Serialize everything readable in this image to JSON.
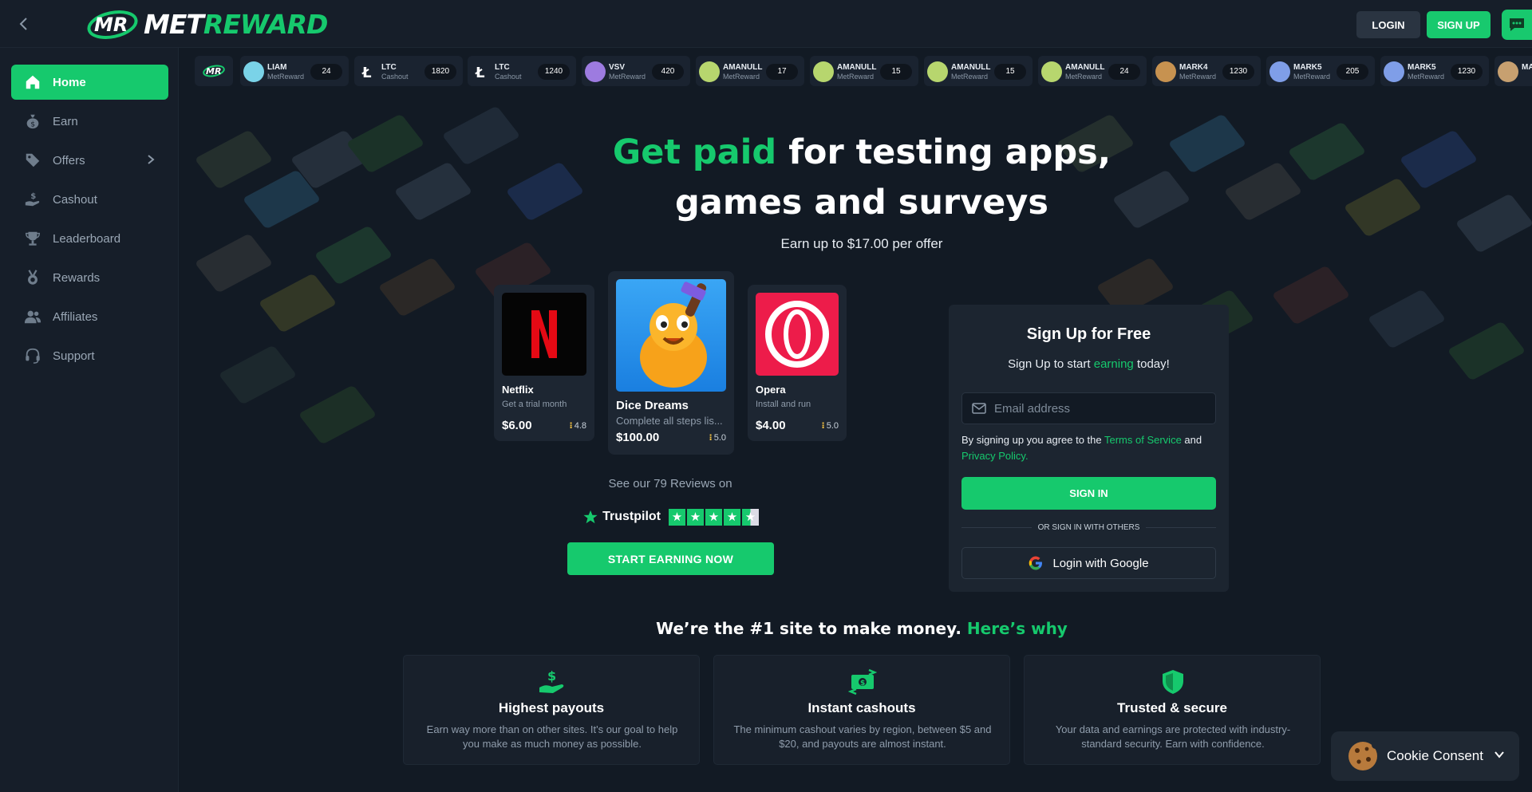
{
  "brand": {
    "name_part1": "MET",
    "name_part2": "REWARD",
    "accent": "#16c96d"
  },
  "header": {
    "login_label": "LOGIN",
    "signup_label": "SIGN UP"
  },
  "sidebar": {
    "items": [
      {
        "label": "Home",
        "icon": "home-icon"
      },
      {
        "label": "Earn",
        "icon": "money-bag-icon"
      },
      {
        "label": "Offers",
        "icon": "tag-icon"
      },
      {
        "label": "Cashout",
        "icon": "cash-hand-icon"
      },
      {
        "label": "Leaderboard",
        "icon": "trophy-icon"
      },
      {
        "label": "Rewards",
        "icon": "medal-icon"
      },
      {
        "label": "Affiliates",
        "icon": "users-icon"
      },
      {
        "label": "Support",
        "icon": "headset-icon"
      }
    ]
  },
  "ticker": [
    {
      "name": "LIAM",
      "sub": "MetReward",
      "amount": "24"
    },
    {
      "name": "LTC",
      "sub": "Cashout",
      "amount": "1820"
    },
    {
      "name": "LTC",
      "sub": "Cashout",
      "amount": "1240"
    },
    {
      "name": "VSV",
      "sub": "MetReward",
      "amount": "420"
    },
    {
      "name": "AMANULL",
      "sub": "MetReward",
      "amount": "17"
    },
    {
      "name": "AMANULL",
      "sub": "MetReward",
      "amount": "15"
    },
    {
      "name": "AMANULL",
      "sub": "MetReward",
      "amount": "15"
    },
    {
      "name": "AMANULL",
      "sub": "MetReward",
      "amount": "24"
    },
    {
      "name": "MARK4",
      "sub": "MetReward",
      "amount": "1230"
    },
    {
      "name": "MARK5",
      "sub": "MetReward",
      "amount": "205"
    },
    {
      "name": "MARK5",
      "sub": "MetReward",
      "amount": "1230"
    },
    {
      "name": "MA",
      "sub": "",
      "amount": ""
    }
  ],
  "hero": {
    "headline_green": "Get paid",
    "headline_rest1": " for testing apps,",
    "headline_line2": "games and surveys",
    "subline": "Earn up to $17.00 per offer"
  },
  "offers": [
    {
      "title": "Netflix",
      "desc": "Get a trial month",
      "price": "$6.00",
      "rating": "4.8"
    },
    {
      "title": "Dice Dreams",
      "desc": "Complete all steps lis...",
      "price": "$100.00",
      "rating": "5.0"
    },
    {
      "title": "Opera",
      "desc": "Install and run",
      "price": "$4.00",
      "rating": "5.0"
    }
  ],
  "reviews": {
    "text": "See our 79 Reviews on",
    "brand": "Trustpilot",
    "stars": 4.5
  },
  "start_button": "START EARNING NOW",
  "signup": {
    "title": "Sign Up for Free",
    "sub_before": "Sign Up to start ",
    "sub_green": "earning",
    "sub_after": " today!",
    "email_placeholder": "Email address",
    "terms_before": "By signing up you agree to the ",
    "terms_link1": "Terms of Service",
    "terms_mid": " and ",
    "terms_link2": "Privacy Policy.",
    "signin_label": "SIGN IN",
    "divider_label": "OR SIGN IN WITH OTHERS",
    "google_label": "Login with Google"
  },
  "why": {
    "title_white": "We’re the #1 site to make money. ",
    "title_green": "Here’s why",
    "features": [
      {
        "title": "Highest payouts",
        "desc": "Earn way more than on other sites. It's our goal to help you make as much money as possible.",
        "icon": "money-hand-icon"
      },
      {
        "title": "Instant cashouts",
        "desc": "The minimum cashout varies by region, between $5 and $20, and payouts are almost instant.",
        "icon": "cash-exchange-icon"
      },
      {
        "title": "Trusted & secure",
        "desc": "Your data and earnings are protected with industry-standard security. Earn with confidence.",
        "icon": "shield-icon"
      }
    ]
  },
  "cookie": {
    "label": "Cookie Consent"
  }
}
